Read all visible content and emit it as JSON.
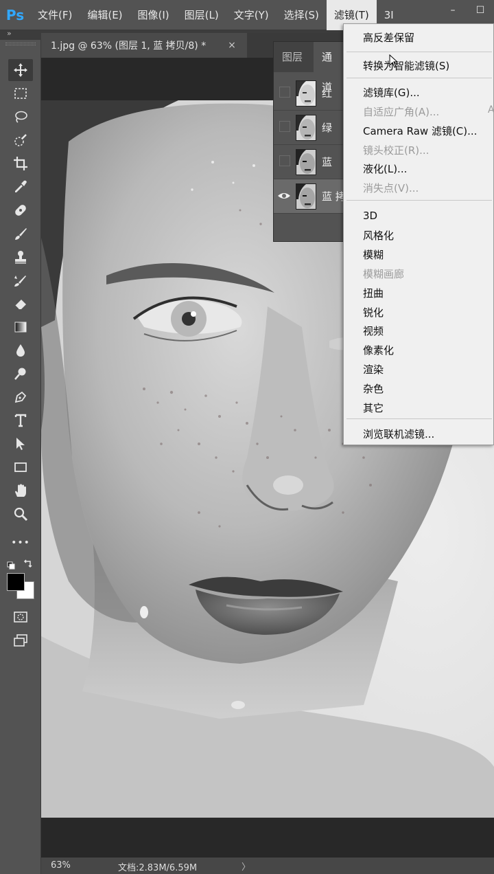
{
  "app": {
    "logo": "Ps"
  },
  "menubar": {
    "items": [
      "文件(F)",
      "编辑(E)",
      "图像(I)",
      "图层(L)",
      "文字(Y)",
      "选择(S)",
      "滤镜(T)",
      "3I"
    ],
    "active": "滤镜(T)"
  },
  "window_controls": {
    "minimize": "–",
    "maximize": "☐"
  },
  "collapse_glyph": "»",
  "document_tab": {
    "title": "1.jpg @ 63% (图层 1, 蓝 拷贝/8) *",
    "close": "×"
  },
  "toolbar": {
    "tools": [
      "move-tool",
      "marquee-tool",
      "lasso-tool",
      "quick-selection-tool",
      "crop-tool",
      "eyedropper-tool",
      "healing-brush-tool",
      "brush-tool",
      "clone-stamp-tool",
      "history-brush-tool",
      "eraser-tool",
      "gradient-tool",
      "blur-tool",
      "dodge-tool",
      "pen-tool",
      "type-tool",
      "path-selection-tool",
      "rectangle-tool",
      "hand-tool",
      "zoom-tool",
      "more-tools"
    ],
    "more_glyph": "•••"
  },
  "panels": {
    "tabs": {
      "layers": "图层",
      "channels": "通道"
    },
    "channels": [
      {
        "label": "红",
        "visible": false
      },
      {
        "label": "绿",
        "visible": false
      },
      {
        "label": "蓝",
        "visible": false
      },
      {
        "label": "蓝 拷",
        "visible": true
      }
    ]
  },
  "filter_menu": {
    "group1": [
      "高反差保留"
    ],
    "group2": [
      "转换为智能滤镜(S)"
    ],
    "group3": [
      {
        "label": "滤镜库(G)...",
        "enabled": true
      },
      {
        "label": "自适应广角(A)...",
        "enabled": false
      },
      {
        "label": "Camera Raw 滤镜(C)...",
        "enabled": true
      },
      {
        "label": "镜头校正(R)...",
        "enabled": false
      },
      {
        "label": "液化(L)...",
        "enabled": true
      },
      {
        "label": "消失点(V)...",
        "enabled": false
      }
    ],
    "shortcut_fragment": "A",
    "group4": [
      {
        "label": "3D",
        "enabled": true
      },
      {
        "label": "风格化",
        "enabled": true
      },
      {
        "label": "模糊",
        "enabled": true
      },
      {
        "label": "模糊画廊",
        "enabled": false
      },
      {
        "label": "扭曲",
        "enabled": true
      },
      {
        "label": "锐化",
        "enabled": true
      },
      {
        "label": "视频",
        "enabled": true
      },
      {
        "label": "像素化",
        "enabled": true
      },
      {
        "label": "渲染",
        "enabled": true
      },
      {
        "label": "杂色",
        "enabled": true
      },
      {
        "label": "其它",
        "enabled": true
      }
    ],
    "group5": [
      "浏览联机滤镜..."
    ]
  },
  "statusbar": {
    "zoom": "63%",
    "doc": "文档:2.83M/6.59M",
    "arrow": "〉"
  }
}
